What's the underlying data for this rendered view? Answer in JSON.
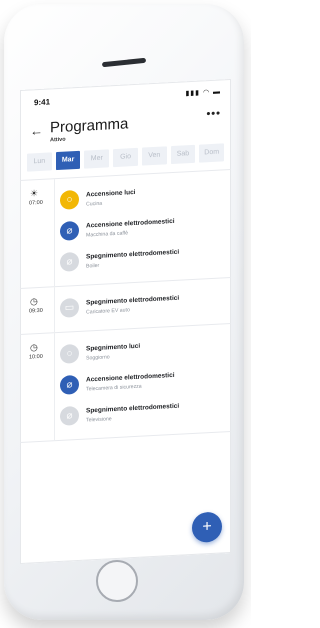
{
  "status_bar": {
    "time": "9:41",
    "icons": "▮▮▮ ◠ ▬"
  },
  "header": {
    "title": "Programma",
    "subtitle": "Attivo",
    "back": "←",
    "more": "•••"
  },
  "days": [
    {
      "label": "Lun",
      "active": false
    },
    {
      "label": "Mar",
      "active": true
    },
    {
      "label": "Mer",
      "active": false
    },
    {
      "label": "Gio",
      "active": false
    },
    {
      "label": "Ven",
      "active": false
    },
    {
      "label": "Sab",
      "active": false
    },
    {
      "label": "Dom",
      "active": false
    }
  ],
  "slots": [
    {
      "time": "07:00",
      "icon": "sunrise-icon",
      "items": [
        {
          "title": "Accensione luci",
          "subtitle": "Cucina",
          "icon": "lightbulb-icon",
          "state": "yellow"
        },
        {
          "title": "Accensione elettrodomestici",
          "subtitle": "Macchina da caffè",
          "icon": "plug-icon",
          "state": "blue"
        },
        {
          "title": "Spegnimento elettrodomestici",
          "subtitle": "Boiler",
          "icon": "plug-icon",
          "state": "gray"
        }
      ]
    },
    {
      "time": "09:30",
      "icon": "clock-icon",
      "items": [
        {
          "title": "Spegnimento elettrodomestici",
          "subtitle": "Caricatore EV auto",
          "icon": "car-icon",
          "state": "gray"
        }
      ]
    },
    {
      "time": "10:00",
      "icon": "clock-icon",
      "items": [
        {
          "title": "Spegnimento luci",
          "subtitle": "Soggiorno",
          "icon": "lightbulb-icon",
          "state": "gray"
        },
        {
          "title": "Accensione elettrodomestici",
          "subtitle": "Telecamera di sicurezza",
          "icon": "plug-icon",
          "state": "blue"
        },
        {
          "title": "Spegnimento elettrodomestici",
          "subtitle": "Televisione",
          "icon": "plug-icon",
          "state": "gray"
        }
      ]
    }
  ],
  "fab": {
    "label": "+"
  },
  "colors": {
    "accent": "#2f5fb5",
    "yellow": "#f2b705",
    "gray": "#d7dadf"
  }
}
